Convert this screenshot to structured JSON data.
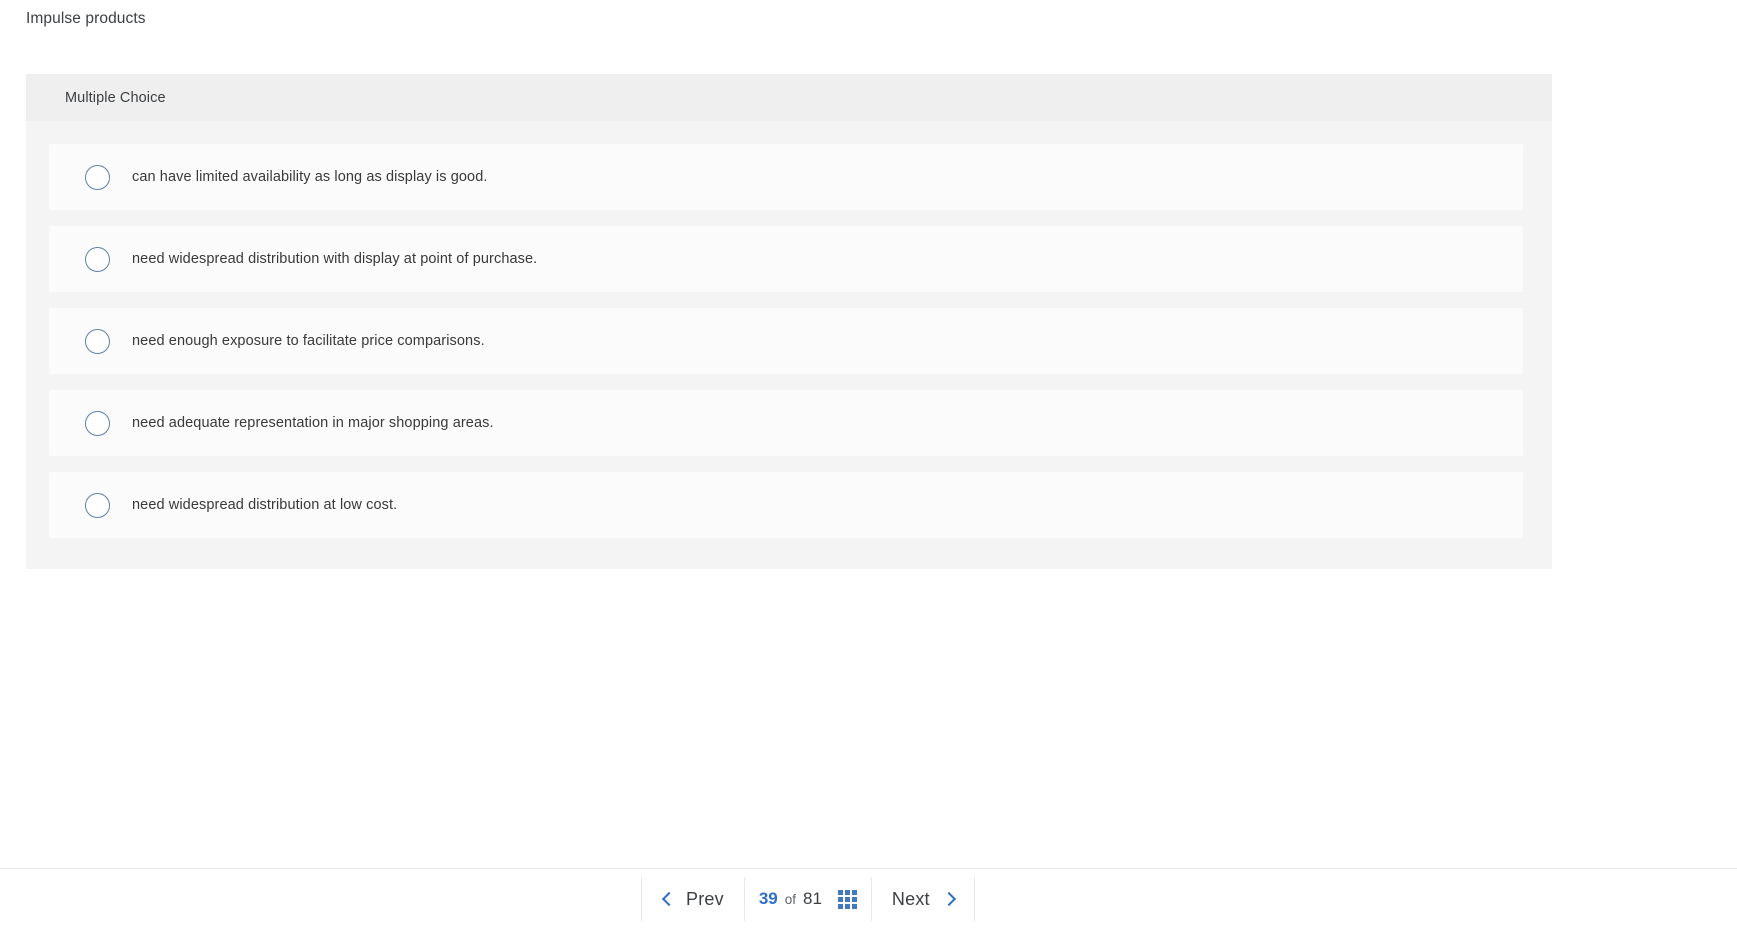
{
  "question": {
    "stem": "Impulse products",
    "type_label": "Multiple Choice",
    "options": [
      {
        "label": "can have limited availability as long as display is good."
      },
      {
        "label": "need widespread distribution with display at point of purchase."
      },
      {
        "label": "need enough exposure to facilitate price comparisons."
      },
      {
        "label": "need adequate representation in major shopping areas."
      },
      {
        "label": "need widespread distribution at low cost."
      }
    ]
  },
  "footer": {
    "prev_label": "Prev",
    "next_label": "Next",
    "current_question": "39",
    "of_label": "of",
    "total_questions": "81",
    "grid_icon_name": "grid-view-icon"
  },
  "colors": {
    "accent_blue": "#2f6fc4",
    "grid_blue": "#4178c0",
    "radio_border": "#607fa8",
    "card_bg": "#f4f4f5",
    "card_header_bg": "#efeff0",
    "option_bg": "#fbfbfb",
    "text_primary": "#3c4043"
  }
}
